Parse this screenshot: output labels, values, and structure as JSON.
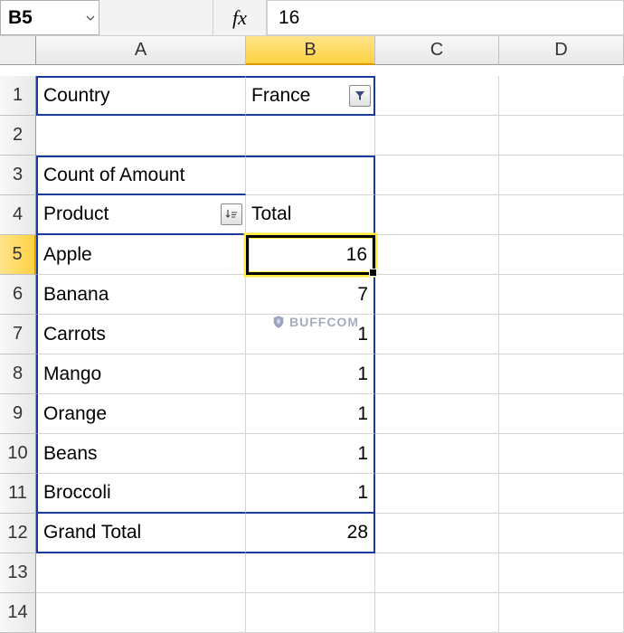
{
  "name_box": "B5",
  "formula_bar_value": "16",
  "fx_label": "fx",
  "columns": [
    "A",
    "B",
    "C",
    "D"
  ],
  "active_col_index": 1,
  "active_row_index": 4,
  "rows": [
    "1",
    "2",
    "3",
    "4",
    "5",
    "6",
    "7",
    "8",
    "9",
    "10",
    "11",
    "12",
    "13",
    "14"
  ],
  "pivot": {
    "page_field_label": "Country",
    "page_field_value": "France",
    "data_field_label": "Count of Amount",
    "row_field_label": "Product",
    "values_header": "Total",
    "items": [
      {
        "label": "Apple",
        "value": "16"
      },
      {
        "label": "Banana",
        "value": "7"
      },
      {
        "label": "Carrots",
        "value": "1"
      },
      {
        "label": "Mango",
        "value": "1"
      },
      {
        "label": "Orange",
        "value": "1"
      },
      {
        "label": "Beans",
        "value": "1"
      },
      {
        "label": "Broccoli",
        "value": "1"
      }
    ],
    "grand_total_label": "Grand Total",
    "grand_total_value": "28"
  },
  "watermark": "BUFFCOM",
  "chart_data": {
    "type": "table",
    "title": "Count of Amount",
    "filter": {
      "Country": "France"
    },
    "columns": [
      "Product",
      "Total"
    ],
    "rows": [
      [
        "Apple",
        16
      ],
      [
        "Banana",
        7
      ],
      [
        "Carrots",
        1
      ],
      [
        "Mango",
        1
      ],
      [
        "Orange",
        1
      ],
      [
        "Beans",
        1
      ],
      [
        "Broccoli",
        1
      ]
    ],
    "grand_total": 28
  }
}
